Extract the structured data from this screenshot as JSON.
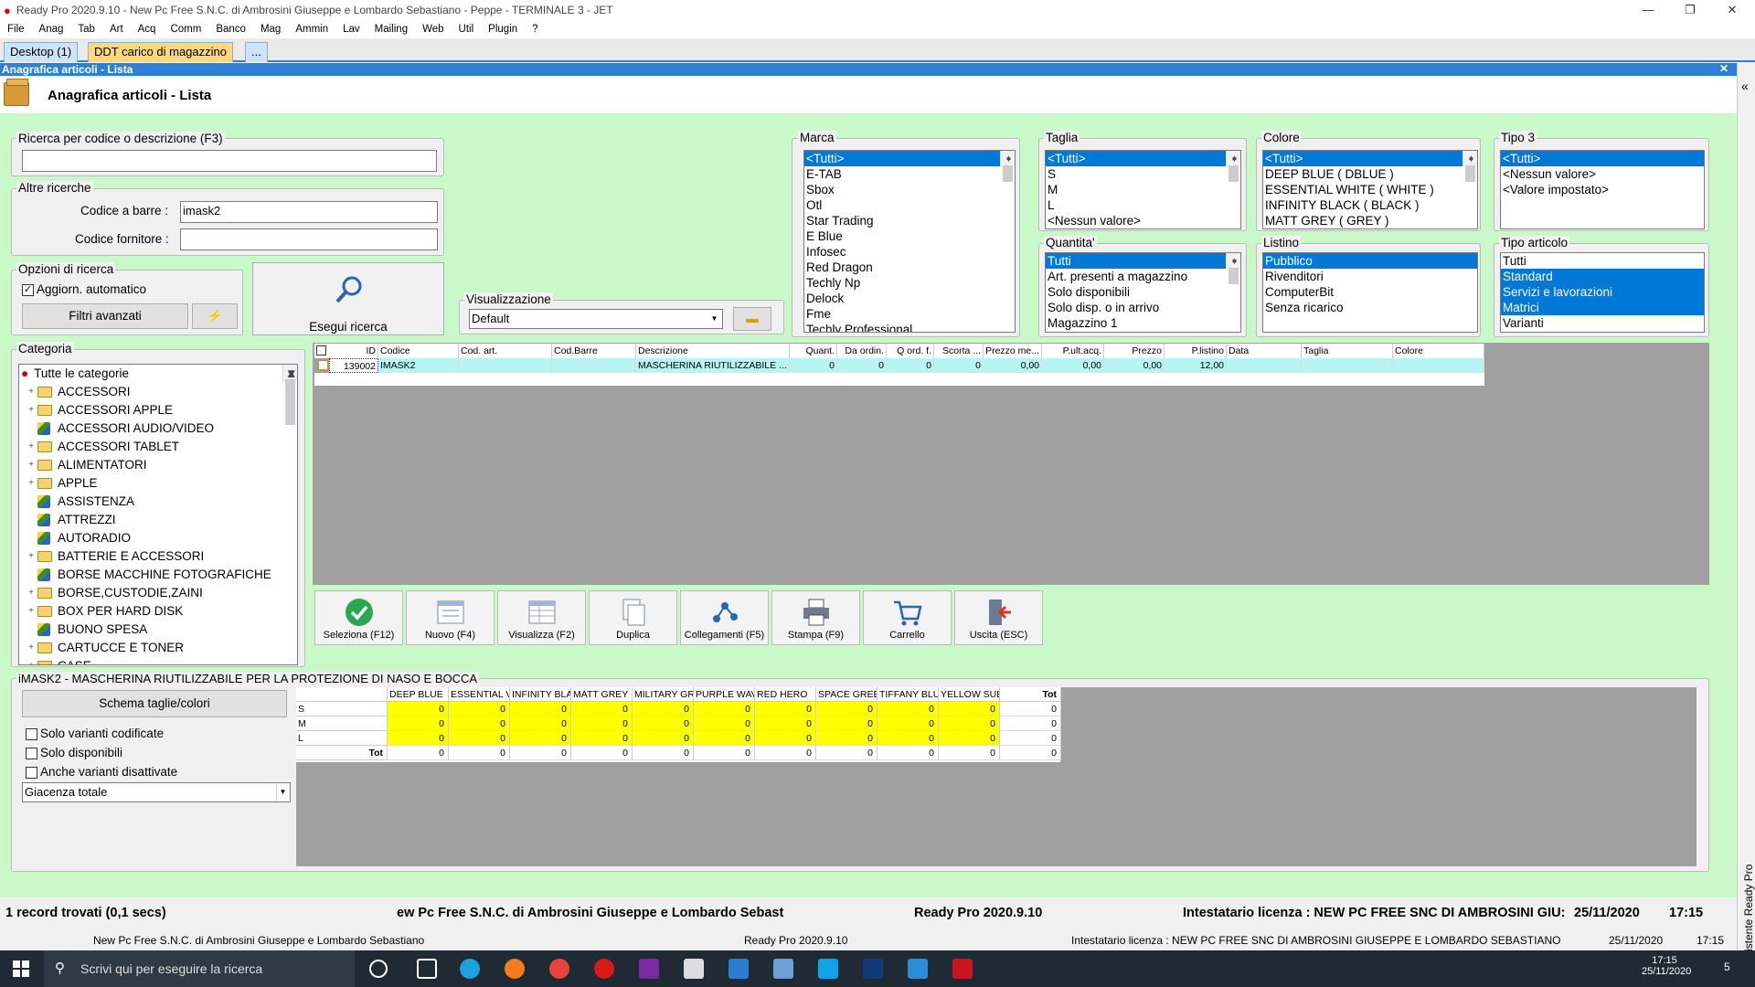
{
  "window": {
    "title": "Ready Pro 2020.9.10 - New Pc Free S.N.C. di Ambrosini Giuseppe e Lombardo Sebastiano - Peppe - TERMINALE 3 - JET",
    "minimize": "—",
    "restore": "❐",
    "close": "✕"
  },
  "menu": [
    "File",
    "Anag",
    "Tab",
    "Art",
    "Acq",
    "Comm",
    "Banco",
    "Mag",
    "Ammin",
    "Lav",
    "Mailing",
    "Web",
    "Util",
    "Plugin",
    "?"
  ],
  "tabs": {
    "desktop": "Desktop (1)",
    "ddt": "DDT carico di magazzino",
    "more": "..."
  },
  "panel": {
    "header": "Anagrafica articoli  - Lista",
    "title": "Anagrafica articoli  - Lista",
    "close": "✕"
  },
  "search": {
    "legend": "Ricerca per codice o descrizione (F3)",
    "value": ""
  },
  "altre": {
    "legend": "Altre ricerche",
    "barcode_label": "Codice a barre :",
    "barcode_value": "imask2",
    "fornitore_label": "Codice fornitore :",
    "fornitore_value": ""
  },
  "opzioni": {
    "legend": "Opzioni di ricerca",
    "auto_label": "Aggiorn. automatico",
    "filtri": "Filtri avanzati",
    "flash": "⚡"
  },
  "esegui": "Esegui ricerca",
  "visual": {
    "legend": "Visualizzazione",
    "value": "Default"
  },
  "marca": {
    "legend": "Marca",
    "items": [
      "<Tutti>",
      "E-TAB",
      "Sbox",
      "Otl",
      "Star Trading",
      "E Blue",
      "Infosec",
      "Red Dragon",
      "Techly Np",
      "Delock",
      "Fme",
      "Techly Professional"
    ]
  },
  "taglia": {
    "legend": "Taglia",
    "items": [
      "<Tutti>",
      "S",
      "M",
      "L",
      "<Nessun valore>"
    ]
  },
  "colore": {
    "legend": "Colore",
    "items": [
      "<Tutti>",
      "DEEP BLUE ( DBLUE )",
      "ESSENTIAL WHITE ( WHITE )",
      "INFINITY BLACK ( BLACK )",
      "MATT GREY ( GREY )"
    ]
  },
  "tipo3": {
    "legend": "Tipo 3",
    "items": [
      "<Tutti>",
      "<Nessun valore>",
      "<Valore impostato>"
    ]
  },
  "quantita": {
    "legend": "Quantita'",
    "items": [
      "Tutti",
      "Art. presenti a magazzino",
      "Solo disponibili",
      "Solo disp. o in arrivo",
      "Magazzino 1"
    ]
  },
  "listino": {
    "legend": "Listino",
    "items": [
      "Pubblico",
      "Rivenditori",
      "ComputerBit",
      "Senza ricarico"
    ]
  },
  "tipoart": {
    "legend": "Tipo articolo",
    "items": [
      "Tutti",
      "Standard",
      "Servizi e lavorazioni",
      "Matrici",
      "Varianti"
    ]
  },
  "categoria": {
    "legend": "Categoria",
    "root": "Tutte le categorie",
    "items": [
      {
        "label": "ACCESSORI",
        "kind": "folder"
      },
      {
        "label": "ACCESSORI APPLE",
        "kind": "folder"
      },
      {
        "label": "ACCESSORI AUDIO/VIDEO",
        "kind": "leaf"
      },
      {
        "label": "ACCESSORI TABLET",
        "kind": "folder"
      },
      {
        "label": "ALIMENTATORI",
        "kind": "folder"
      },
      {
        "label": "APPLE",
        "kind": "folder"
      },
      {
        "label": "ASSISTENZA",
        "kind": "leaf"
      },
      {
        "label": "ATTREZZI",
        "kind": "leaf"
      },
      {
        "label": "AUTORADIO",
        "kind": "leaf"
      },
      {
        "label": "BATTERIE E ACCESSORI",
        "kind": "folder"
      },
      {
        "label": "BORSE MACCHINE FOTOGRAFICHE",
        "kind": "leaf"
      },
      {
        "label": "BORSE,CUSTODIE,ZAINI",
        "kind": "folder"
      },
      {
        "label": "BOX PER HARD DISK",
        "kind": "folder"
      },
      {
        "label": "BUONO SPESA",
        "kind": "leaf"
      },
      {
        "label": "CARTUCCE E TONER",
        "kind": "folder"
      },
      {
        "label": "CASE",
        "kind": "folder"
      }
    ]
  },
  "grid": {
    "headers": [
      "ID",
      "Codice",
      "Cod. art.",
      "Cod.Barre",
      "Descrizione",
      "Quant.",
      "Da ordin.",
      "Q ord. f.",
      "Scorta ...",
      "Prezzo me...",
      "P.ult.acq.",
      "Prezzo",
      "P.listino",
      "Data",
      "Taglia",
      "Colore"
    ],
    "rows": [
      [
        "139002",
        "IMASK2",
        "",
        "",
        "MASCHERINA RIUTILIZZABILE ...",
        "0",
        "0",
        "0",
        "0",
        "0,00",
        "0,00",
        "0,00",
        "12,00",
        "",
        "",
        ""
      ]
    ]
  },
  "toolbar": [
    "Seleziona (F12)",
    "Nuovo (F4)",
    "Visualizza (F2)",
    "Duplica",
    "Collegamenti (F5)",
    "Stampa (F9)",
    "Carrello",
    "Uscita (ESC)"
  ],
  "detail": {
    "title": "iMASK2 - MASCHERINA RIUTILIZZABILE PER LA PROTEZIONE DI NASO E BOCCA",
    "schema": "Schema taglie/colori",
    "opt1": "Solo varianti codificate",
    "opt2": "Solo disponibili",
    "opt3": "Anche varianti disattivate",
    "giacenza": "Giacenza totale"
  },
  "matrix": {
    "cols": [
      "DEEP BLUE",
      "ESSENTIAL V",
      "INFINITY BLA",
      "MATT GREY",
      "MILITARY GR",
      "PURPLE WAV",
      "RED HERO",
      "SPACE GREE",
      "TIFFANY BLU",
      "YELLOW SUB",
      "Tot"
    ],
    "rows": [
      {
        "label": "S",
        "values": [
          "0",
          "0",
          "0",
          "0",
          "0",
          "0",
          "0",
          "0",
          "0",
          "0",
          "0"
        ]
      },
      {
        "label": "M",
        "values": [
          "0",
          "0",
          "0",
          "0",
          "0",
          "0",
          "0",
          "0",
          "0",
          "0",
          "0"
        ]
      },
      {
        "label": "L",
        "values": [
          "0",
          "0",
          "0",
          "0",
          "0",
          "0",
          "0",
          "0",
          "0",
          "0",
          "0"
        ]
      },
      {
        "label": "Tot",
        "values": [
          "0",
          "0",
          "0",
          "0",
          "0",
          "0",
          "0",
          "0",
          "0",
          "0",
          "0"
        ]
      }
    ]
  },
  "status": {
    "records": "1 record trovati (0,1 secs)",
    "company": "ew Pc Free S.N.C. di Ambrosini Giuseppe e Lombardo Sebastiar",
    "version": "Ready Pro 2020.9.10",
    "license": "Intestatario licenza : NEW PC FREE SNC DI AMBROSINI GIU:",
    "date": "25/11/2020",
    "time": "17:15"
  },
  "status2": {
    "company": "New Pc Free S.N.C. di Ambrosini Giuseppe e Lombardo Sebastiano",
    "version": "Ready Pro 2020.9.10",
    "license": "Intestatario licenza : NEW PC FREE SNC DI AMBROSINI GIUSEPPE E LOMBARDO SEBASTIANO",
    "date": "25/11/2020",
    "time": "17:15"
  },
  "rightpane": {
    "collapse": "«",
    "label": "Assistente Ready Pro"
  },
  "taskbar": {
    "search": "Scrivi qui per eseguire la ricerca",
    "time": "17:15",
    "date": "25/11/2020",
    "notif": "5"
  }
}
